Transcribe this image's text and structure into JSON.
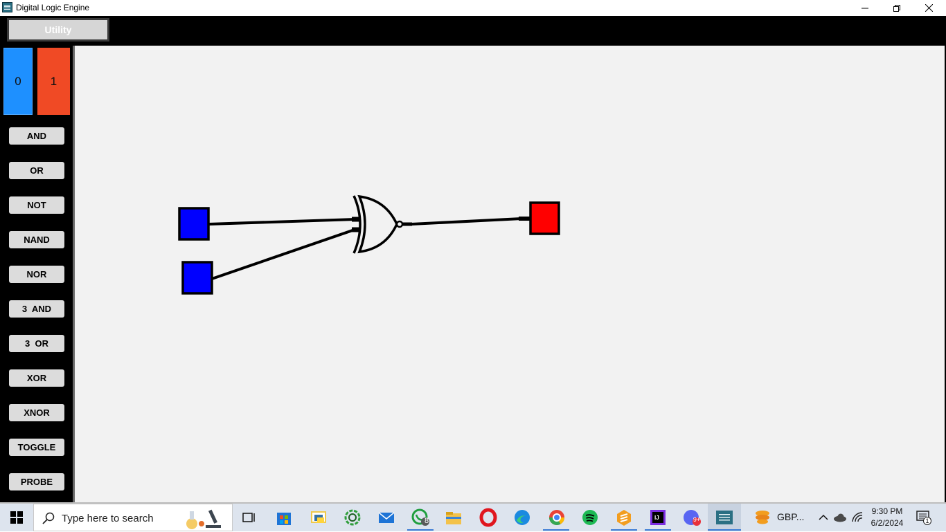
{
  "window": {
    "title": "Digital Logic Engine",
    "icon": "app-logo-icon",
    "controls": [
      "minimize-icon",
      "restore-icon",
      "close-icon"
    ]
  },
  "toolbar": {
    "utility_label": "Utility"
  },
  "sidebar": {
    "switch_low_label": "0",
    "switch_high_label": "1",
    "colors": {
      "low": "#1e90ff",
      "high": "#f04a25"
    },
    "gates": [
      {
        "label": "AND"
      },
      {
        "label": "OR"
      },
      {
        "label": "NOT"
      },
      {
        "label": "NAND"
      },
      {
        "label": "NOR"
      },
      {
        "label": "3  AND"
      },
      {
        "label": "3  OR"
      },
      {
        "label": "XOR"
      },
      {
        "label": "XNOR"
      },
      {
        "label": "TOGGLE"
      },
      {
        "label": "PROBE"
      }
    ]
  },
  "circuit": {
    "components": [
      {
        "type": "input-switch",
        "state": 0,
        "color": "#0000ff"
      },
      {
        "type": "input-switch",
        "state": 0,
        "color": "#0000ff"
      },
      {
        "type": "xnor-gate"
      },
      {
        "type": "output-probe",
        "state": 1,
        "color": "#ff0000"
      }
    ],
    "wires": 3
  },
  "taskbar": {
    "search_placeholder": "Type here to search",
    "whatsapp_badge": "8",
    "chat_badge": "9+",
    "tray_text": "GBP...",
    "time": "9:30 PM",
    "date": "6/2/2024",
    "notification_count": "1",
    "pinned_icons": [
      "labs-icon",
      "task-view-icon",
      "store-icon",
      "python-icon",
      "sync-icon",
      "mail-icon",
      "whatsapp-icon",
      "file-explorer-icon",
      "opera-icon",
      "edge-icon",
      "chrome-icon",
      "spotify-icon",
      "sublime-icon",
      "intellij-icon",
      "chat-icon",
      "digital-logic-icon",
      "crypto-icon"
    ]
  }
}
